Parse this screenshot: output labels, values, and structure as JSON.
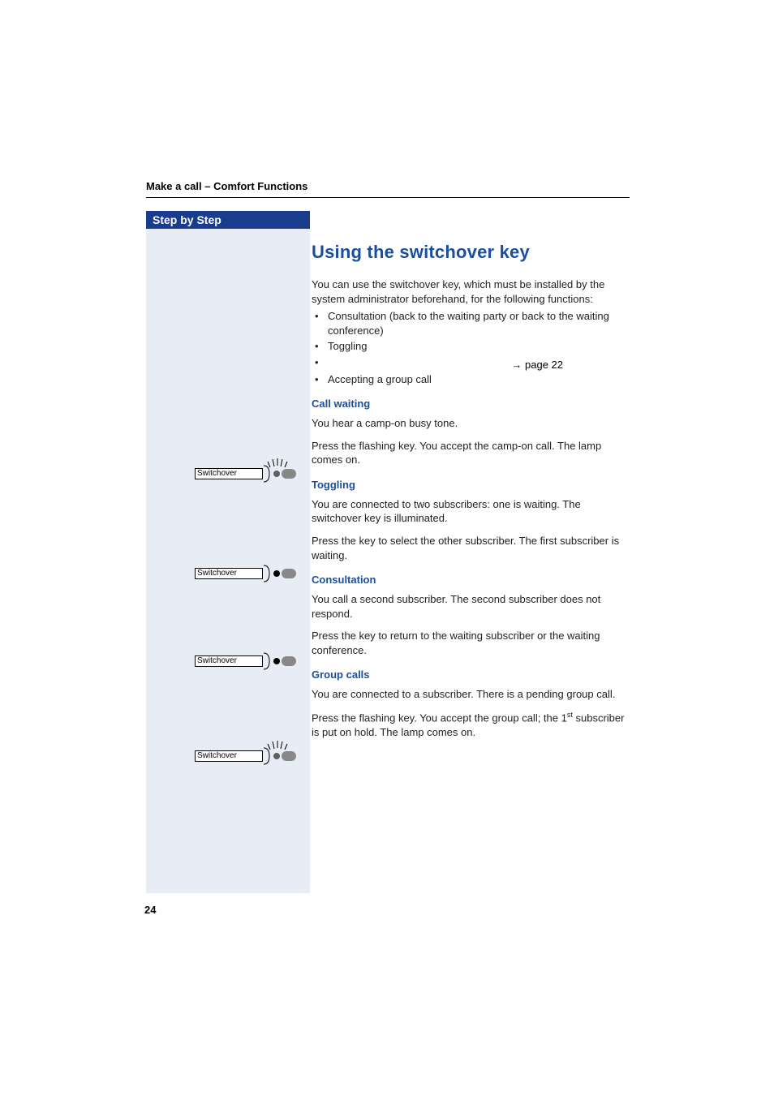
{
  "header": "Make a call – Comfort Functions",
  "sidebar": {
    "tab": "Step by Step",
    "key_label": "Switchover"
  },
  "content": {
    "title": "Using the switchover key",
    "intro": "You can use the switchover key, which must be installed by the system administrator beforehand, for the following functions:",
    "bullets_top": [
      "Consultation (back to the waiting party or back to the waiting conference)",
      "Toggling",
      ""
    ],
    "page_ref_arrow": "→",
    "page_ref": "page 22",
    "bullets_after": [
      "Accepting a group call"
    ],
    "sections": [
      {
        "head": "Call waiting",
        "p1": "You hear a camp-on busy tone.",
        "p2": "Press the flashing key. You accept the camp-on call. The lamp comes on."
      },
      {
        "head": "Toggling",
        "p1": "You are connected to two subscribers: one is waiting. The switchover key is illuminated.",
        "p2": "Press the key to select the other subscriber. The first subscriber is waiting."
      },
      {
        "head": "Consultation",
        "p1": "You call a second subscriber. The second subscriber does not respond.",
        "p2": "Press the key to return to the waiting subscriber or the waiting conference."
      },
      {
        "head": "Group calls",
        "p1": "You are connected to a subscriber. There is a pending group call.",
        "p2_pre": "Press the flashing key. You accept the group call; the 1",
        "p2_sup": "st",
        "p2_post": " subscriber is put on hold. The lamp comes on."
      }
    ]
  },
  "page_number": "24"
}
